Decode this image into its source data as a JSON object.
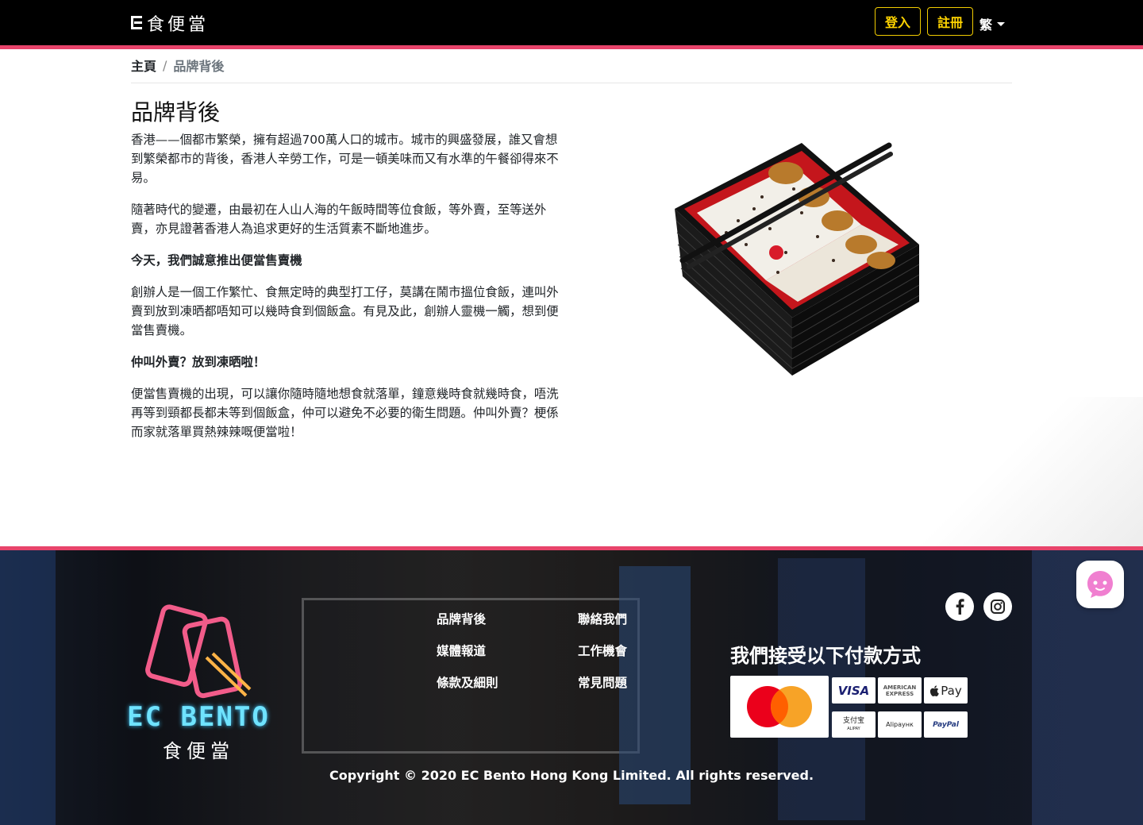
{
  "brand": {
    "logo_text": "食便當",
    "footer_logo_en": "EC BENTO",
    "footer_logo_zh": "食便當"
  },
  "nav": {
    "login": "登入",
    "register": "註冊",
    "language": "繁"
  },
  "breadcrumb": {
    "home": "主頁",
    "separator": "/",
    "current": "品牌背後"
  },
  "page": {
    "title": "品牌背後",
    "paragraphs": [
      "香港——個都市繁榮，擁有超過700萬人口的城市。城市的興盛發展，誰又會想到繁榮都市的背後，香港人辛勞工作，可是一頓美味而又有水準的午餐卻得來不易。",
      "隨著時代的變遷，由最初在人山人海的午飯時間等位食飯，等外賣，至等送外賣，亦見證著香港人為追求更好的生活質素不斷地進步。",
      "今天，我們誠意推出便當售賣機",
      "創辦人是一個工作繁忙、食無定時的典型打工仔，莫講在鬧市搵位食飯，連叫外賣到放到凍晒都唔知可以幾時食到個飯盒。有見及此，創辦人靈機一觸，想到便當售賣機。",
      "仲叫外賣？放到凍晒啦！",
      "便當售賣機的出現，可以讓你隨時隨地想食就落單，鐘意幾時食就幾時食，唔洗再等到頸都長都未等到個飯盒，仲可以避免不必要的衛生問題。仲叫外賣？梗係而家就落單買熱辣辣嘅便當啦！"
    ]
  },
  "footer": {
    "links_col1": [
      "品牌背後",
      "媒體報道",
      "條款及細則"
    ],
    "links_col2": [
      "聯絡我們",
      "工作機會",
      "常見問題"
    ],
    "payment_title": "我們接受以下付款方式",
    "payment_methods": [
      "Mastercard",
      "VISA",
      "AMERICAN EXPRESS",
      "Pay",
      "支付宝",
      "Alipayнк",
      "PayPal"
    ],
    "alipay_sub": "ALIPAY",
    "copyright": "Copyright © 2020 EC Bento Hong Kong Limited. All rights reserved."
  },
  "colors": {
    "accent_pink": "#e8446b",
    "nav_yellow": "#ffd400",
    "neon_blue": "#4fd6ff"
  },
  "icons": {
    "facebook": "facebook-icon",
    "instagram": "instagram-icon",
    "chat": "chat-bot-icon"
  }
}
